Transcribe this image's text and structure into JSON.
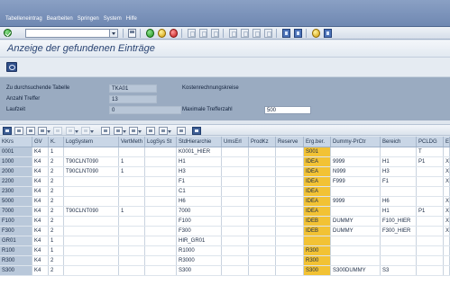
{
  "menu": {
    "items": [
      "Tabelleneintrag",
      "Bearbeiten",
      "Springen",
      "System",
      "Hilfe"
    ]
  },
  "page_title": "Anzeige der gefundenen Einträge",
  "selection": {
    "table_label": "Zu durchsuchende Tabelle",
    "table_value": "TKA01",
    "table_desc": "Kostenrechnungskreise",
    "hits_label": "Anzahl Treffer",
    "hits_value": "13",
    "runtime_label": "Laufzeit",
    "runtime_value": "0",
    "max_label": "Maximale Trefferzahl",
    "max_value": "500"
  },
  "table": {
    "headers": [
      "KKrs",
      "GV",
      "K.",
      "LogSystem",
      "VertMeth",
      "LogSys St",
      "StdHierarchie",
      "UmsErl",
      "ProdKz",
      "Reserve",
      "Erg.ber.",
      "Dummy-PrCtr",
      "Bereich",
      "PCLDG",
      "E"
    ],
    "rows": [
      [
        "0001",
        "K4",
        "1",
        "",
        "",
        "",
        "K0001_HIER",
        "",
        "",
        "",
        "S001",
        "",
        "",
        "T",
        ""
      ],
      [
        "1000",
        "K4",
        "2",
        "T90CLNT090",
        "1",
        "",
        "H1",
        "",
        "",
        "",
        "IDEA",
        "9999",
        "H1",
        "P1",
        "X"
      ],
      [
        "2000",
        "K4",
        "2",
        "T90CLNT090",
        "1",
        "",
        "H3",
        "",
        "",
        "",
        "IDEA",
        "N999",
        "H3",
        "",
        "X"
      ],
      [
        "2200",
        "K4",
        "2",
        "",
        "",
        "",
        "F1",
        "",
        "",
        "",
        "IDEA",
        "F999",
        "F1",
        "",
        "X"
      ],
      [
        "2300",
        "K4",
        "2",
        "",
        "",
        "",
        "C1",
        "",
        "",
        "",
        "IDEA",
        "",
        "",
        "",
        ""
      ],
      [
        "5000",
        "K4",
        "2",
        "",
        "",
        "",
        "H6",
        "",
        "",
        "",
        "IDEA",
        "9999",
        "H6",
        "",
        "X"
      ],
      [
        "7000",
        "K4",
        "2",
        "T90CLNT090",
        "1",
        "",
        "7000",
        "",
        "",
        "",
        "IDEA",
        "",
        "H1",
        "P1",
        "X"
      ],
      [
        "F100",
        "K4",
        "2",
        "",
        "",
        "",
        "F100",
        "",
        "",
        "",
        "IDEB",
        "DUMMY",
        "F100_HIER",
        "",
        "X"
      ],
      [
        "F300",
        "K4",
        "2",
        "",
        "",
        "",
        "F300",
        "",
        "",
        "",
        "IDEB",
        "DUMMY",
        "F300_HIER",
        "",
        "X"
      ],
      [
        "GR01",
        "K4",
        "1",
        "",
        "",
        "",
        "HIR_GR01",
        "",
        "",
        "",
        "",
        "",
        "",
        "",
        ""
      ],
      [
        "R100",
        "K4",
        "1",
        "",
        "",
        "",
        "R1000",
        "",
        "",
        "",
        "R300",
        "",
        "",
        "",
        ""
      ],
      [
        "R300",
        "K4",
        "2",
        "",
        "",
        "",
        "R3000",
        "",
        "",
        "",
        "R300",
        "",
        "",
        "",
        ""
      ],
      [
        "S300",
        "K4",
        "2",
        "",
        "",
        "",
        "S300",
        "",
        "",
        "",
        "S300",
        "S300DUMMY",
        "S3",
        "",
        ""
      ]
    ]
  }
}
